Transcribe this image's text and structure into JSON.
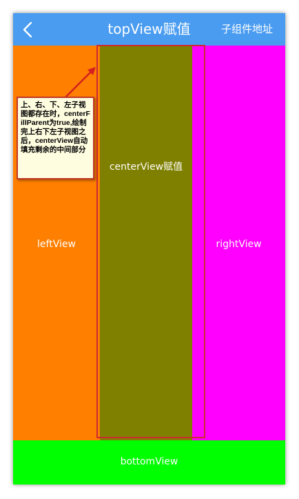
{
  "topbar": {
    "title": "topView赋值",
    "right_action": "子组件地址",
    "back_icon": "chevron-left-icon",
    "bg_color": "#4a9cf0"
  },
  "views": {
    "left": {
      "label": "leftView",
      "color": "#ff7f00"
    },
    "center": {
      "label": "centerView赋值",
      "color": "#7f7f00"
    },
    "right": {
      "label": "rightView",
      "color": "#ff00ff"
    },
    "bottom": {
      "label": "bottomView",
      "color": "#00ff00"
    }
  },
  "annotation": {
    "text": "上、右、下、左子视图都存在时，centerFillParent为true,绘制完上右下左子视图之后，centerView自动填充剩余的中间部分"
  }
}
